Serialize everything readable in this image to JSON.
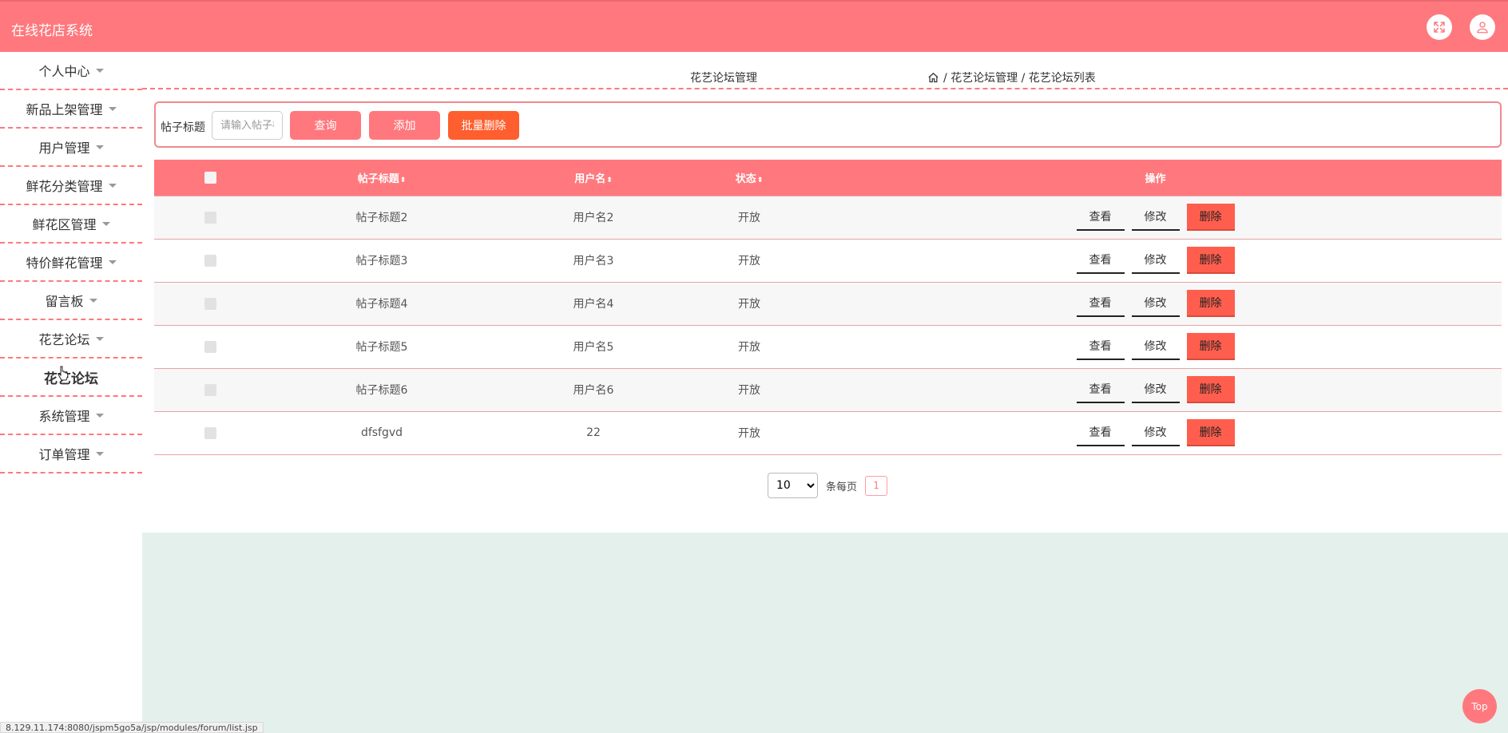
{
  "app": {
    "title": "在线花店系统"
  },
  "header": {
    "fullscreen_icon": "expand-icon",
    "user_icon": "user-icon"
  },
  "sidebar": {
    "items": [
      {
        "label": "个人中心",
        "caret": true
      },
      {
        "label": "新品上架管理",
        "caret": true
      },
      {
        "label": "用户管理",
        "caret": true
      },
      {
        "label": "鲜花分类管理",
        "caret": true
      },
      {
        "label": "鲜花区管理",
        "caret": true
      },
      {
        "label": "特价鲜花管理",
        "caret": true
      },
      {
        "label": "留言板",
        "caret": true
      },
      {
        "label": "花艺论坛",
        "caret": true
      },
      {
        "label": "花艺论坛",
        "caret": false,
        "active": true
      },
      {
        "label": "系统管理",
        "caret": true
      },
      {
        "label": "订单管理",
        "caret": true
      }
    ]
  },
  "breadcrumb": {
    "page_title": "花艺论坛管理",
    "path": "/ 花艺论坛管理 / 花艺论坛列表"
  },
  "search": {
    "label": "帖子标题",
    "placeholder": "请输入帖子标题",
    "query_label": "查询",
    "add_label": "添加",
    "batch_delete_label": "批量删除"
  },
  "table": {
    "columns": [
      "帖子标题",
      "用户名",
      "状态",
      "操作"
    ],
    "sort_glyph": "⬍",
    "rows": [
      {
        "title": "帖子标题2",
        "user": "用户名2",
        "status": "开放"
      },
      {
        "title": "帖子标题3",
        "user": "用户名3",
        "status": "开放"
      },
      {
        "title": "帖子标题4",
        "user": "用户名4",
        "status": "开放"
      },
      {
        "title": "帖子标题5",
        "user": "用户名5",
        "status": "开放"
      },
      {
        "title": "帖子标题6",
        "user": "用户名6",
        "status": "开放"
      },
      {
        "title": "dfsfgvd",
        "user": "22",
        "status": "开放"
      }
    ],
    "actions": {
      "view": "查看",
      "edit": "修改",
      "delete": "删除"
    }
  },
  "pagination": {
    "page_size": "10",
    "page_size_options": [
      "10"
    ],
    "per_page_label": "条每页",
    "current_page": "1"
  },
  "top_button": "Top",
  "status_url": "8.129.11.174:8080/jspm5go5a/jsp/modules/forum/list.jsp",
  "colors": {
    "primary": "#ff787d",
    "danger": "#ff5e2e",
    "background": "#e4f0ec"
  }
}
